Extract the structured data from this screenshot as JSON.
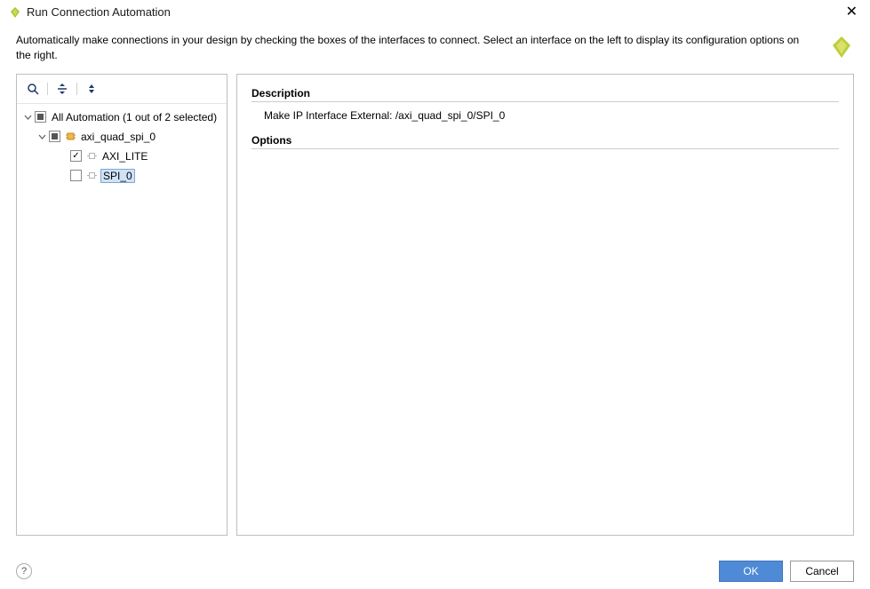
{
  "window": {
    "title": "Run Connection Automation"
  },
  "header": {
    "instructions": "Automatically make connections in your design by checking the boxes of the interfaces to connect. Select an interface on the left to display its configuration options on the right."
  },
  "tree": {
    "root": {
      "label": "All Automation (1 out of 2 selected)",
      "state": "partial"
    },
    "ip": {
      "label": "axi_quad_spi_0",
      "state": "partial"
    },
    "if1": {
      "label": "AXI_LITE",
      "checked": true
    },
    "if2": {
      "label": "SPI_0",
      "checked": false,
      "selected": true
    }
  },
  "details": {
    "description_heading": "Description",
    "description_text": "Make IP Interface External: /axi_quad_spi_0/SPI_0",
    "options_heading": "Options"
  },
  "buttons": {
    "ok": "OK",
    "cancel": "Cancel"
  }
}
